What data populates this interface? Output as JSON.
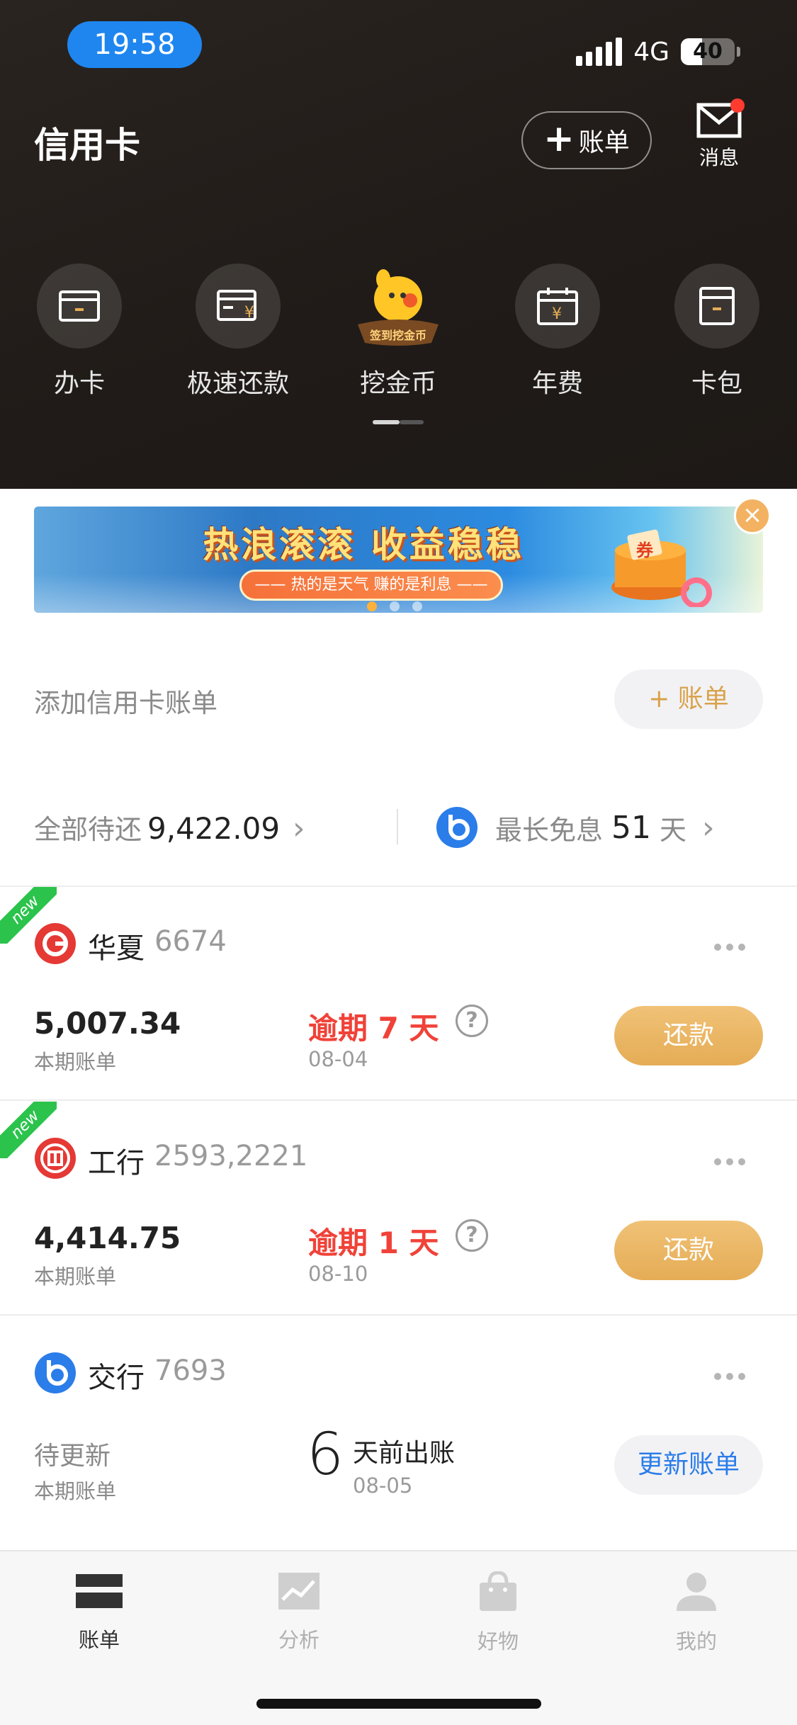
{
  "status_bar": {
    "time": "19:58",
    "network": "4G",
    "battery": "40",
    "battery_level": 0.4
  },
  "header": {
    "title": "信用卡",
    "add_bill_label": "账单",
    "message_label": "消息",
    "has_unread": true
  },
  "quick_actions": [
    {
      "label": "办卡",
      "icon": "card-icon"
    },
    {
      "label": "极速还款",
      "icon": "fast-repay-icon"
    },
    {
      "label": "挖金币",
      "icon": "mascot-icon",
      "badge": "签到挖金币"
    },
    {
      "label": "年费",
      "icon": "calendar-yen-icon"
    },
    {
      "label": "卡包",
      "icon": "card-wallet-icon"
    }
  ],
  "banner": {
    "title": "热浪滚滚 收益稳稳",
    "subtitle": "—— 热的是天气 赚的是利息 ——",
    "gift_text": "券",
    "active_dot": 0
  },
  "add_row": {
    "label": "添加信用卡账单",
    "button": "+ 账单"
  },
  "summary": {
    "pending_label": "全部待还",
    "pending_value": "9,422.09",
    "free_label": "最长免息",
    "free_days": "51",
    "free_unit": "天"
  },
  "cards": [
    {
      "is_new": true,
      "new_label": "new",
      "bank": "华夏",
      "number": "6674",
      "amount": "5,007.34",
      "amount_label": "本期账单",
      "status": "逾期 7 天",
      "date": "08-04",
      "button": "还款",
      "logo_color": "#e53935"
    },
    {
      "is_new": true,
      "new_label": "new",
      "bank": "工行",
      "number": "2593,2221",
      "amount": "4,414.75",
      "amount_label": "本期账单",
      "status": "逾期 1 天",
      "date": "08-10",
      "button": "还款",
      "logo_color": "#e53935"
    },
    {
      "is_new": false,
      "bank": "交行",
      "number": "7693",
      "pending": "待更新",
      "amount_label": "本期账单",
      "days": "6",
      "days_text": "天前出账",
      "date": "08-05",
      "button": "更新账单",
      "logo_color": "#2b7de9"
    }
  ],
  "tabs": [
    {
      "label": "账单",
      "icon": "bill-icon",
      "active": true
    },
    {
      "label": "分析",
      "icon": "analysis-icon",
      "active": false
    },
    {
      "label": "好物",
      "icon": "shopping-bag-icon",
      "active": false
    },
    {
      "label": "我的",
      "icon": "profile-icon",
      "active": false
    }
  ],
  "colors": {
    "accent": "#e5ac55",
    "overdue": "#f04238",
    "link": "#2b7de9",
    "header_bg": "#221d1a"
  }
}
